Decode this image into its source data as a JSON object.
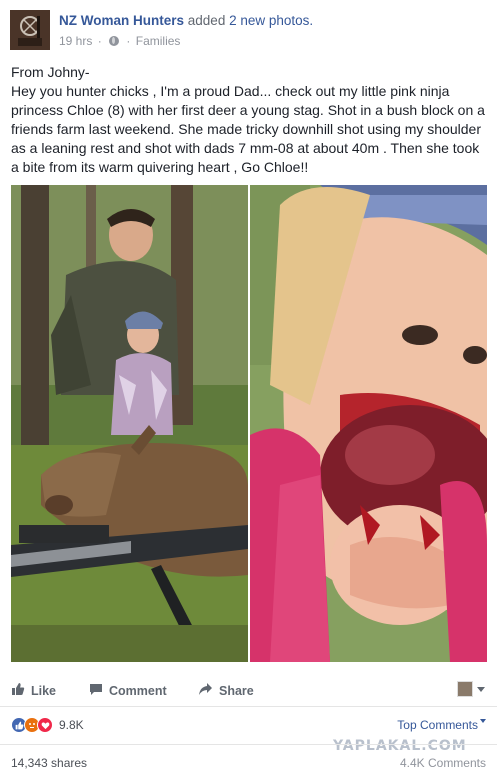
{
  "post": {
    "page_name": "NZ Woman Hunters",
    "action_text": "added",
    "action_count": "2 new photos.",
    "time": "19 hrs",
    "audience": "Families",
    "text_lines": [
      "From Johny-",
      "Hey you hunter chicks , I'm a proud Dad... check out my little pink ninja princess Chloe (8) with her first deer a young stag. Shot in a bush block on a friends farm last weekend. She made tricky downhill shot using my shoulder as a leaning rest and shot with dads 7 mm-08 at about 40m . Then she took a bite from its warm quivering heart , Go Chloe!!"
    ]
  },
  "photos": [
    {
      "icon": "photo-hunter-with-deer"
    },
    {
      "icon": "photo-girl-eating-heart"
    }
  ],
  "actions": {
    "like": "Like",
    "comment": "Comment",
    "share": "Share"
  },
  "stats": {
    "reactions_count": "9.8K",
    "top_comments": "Top Comments",
    "shares": "14,343 shares",
    "comments": "4.4K Comments"
  },
  "watermark": "YAPLAKAL.COM",
  "colors": {
    "link": "#365899",
    "like_blue": "#4267b2",
    "angry_orange": "#e9710f",
    "love_red": "#f0284a"
  }
}
